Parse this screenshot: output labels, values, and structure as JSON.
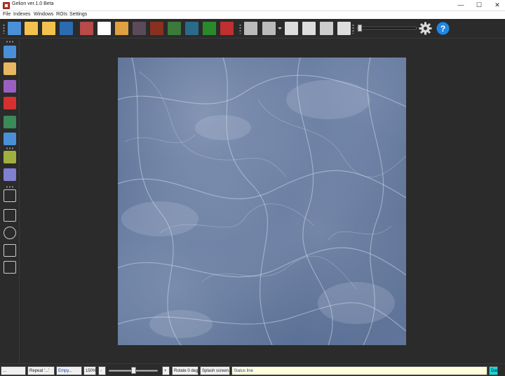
{
  "window": {
    "title": "Gelion ver.1.0 Beta",
    "controls": {
      "minimize": "—",
      "maximize": "☐",
      "close": "✕"
    }
  },
  "menu": {
    "items": [
      "File",
      "Indexes",
      "Windows",
      "ROIs",
      "Settings"
    ]
  },
  "toolbar": {
    "buttons": [
      {
        "name": "open-image-icon",
        "color": "#4a90d9"
      },
      {
        "name": "open-folder-icon",
        "color": "#f2c14e"
      },
      {
        "name": "open-folder-2-icon",
        "color": "#f2c14e"
      },
      {
        "name": "save-disk-icon",
        "color": "#2b6cb0"
      },
      {
        "name": "spectrum-image-icon",
        "color": "#b84a4a"
      },
      {
        "name": "scatter-plot-icon",
        "color": "#ffffff"
      },
      {
        "name": "rainbow-map-icon",
        "color": "#e0a040"
      },
      {
        "name": "dark-texture-icon",
        "color": "#5a4a5a"
      },
      {
        "name": "dots-image-icon",
        "color": "#8a3020"
      },
      {
        "name": "green-texture-icon",
        "color": "#3a7a3a"
      },
      {
        "name": "blue-green-texture-icon",
        "color": "#2a6a8a"
      },
      {
        "name": "leaf-image-icon",
        "color": "#2a8a2a"
      },
      {
        "name": "red-pattern-icon",
        "color": "#c03030"
      },
      {
        "name": "maple-leaf-icon",
        "color": "#bbbbbb"
      },
      {
        "name": "maple-leaf-dropdown-icon",
        "color": "#bbbbbb"
      },
      {
        "name": "histogram-icon",
        "color": "#dddddd"
      },
      {
        "name": "bar-chart-icon",
        "color": "#dddddd"
      },
      {
        "name": "calculator-icon",
        "color": "#cccccc"
      },
      {
        "name": "molecule-icon",
        "color": "#dddddd"
      }
    ],
    "settings_icon": "gear-icon",
    "help_icon": "help-icon",
    "help_glyph": "?"
  },
  "left_toolbar": {
    "buttons": [
      {
        "name": "windows-icon",
        "color": "#4a90d9"
      },
      {
        "name": "palette-icon",
        "color": "#e8b860"
      },
      {
        "name": "rainbow-prism-icon",
        "color": "#9a60c0"
      },
      {
        "name": "theater-masks-icon",
        "color": "#d83030"
      },
      {
        "name": "glasses-icon",
        "color": "#3a8a5a"
      },
      {
        "name": "close-window-icon",
        "color": "#4a90d9"
      },
      {
        "name": "clipboard-list-icon",
        "color": "#a0b040"
      },
      {
        "name": "scroll-icon",
        "color": "#8080d0"
      },
      {
        "name": "pin-tool-icon",
        "color": "#cccccc"
      },
      {
        "name": "rectangle-tool-icon",
        "color": "#cccccc"
      },
      {
        "name": "ellipse-tool-icon",
        "color": "#cccccc"
      },
      {
        "name": "polyline-tool-icon",
        "color": "#cccccc"
      },
      {
        "name": "polygon-tool-icon",
        "color": "#cccccc"
      }
    ]
  },
  "statusbar": {
    "cell0": "...",
    "repeat": "Repeat '...'",
    "empty": "Empy...",
    "zoom": "150%",
    "zoom_minus": "-",
    "zoom_plus": "+",
    "rotate": "Rotate 0 deg.",
    "splash": "Splash screen...",
    "status": "Status line",
    "theme": "Dark"
  }
}
